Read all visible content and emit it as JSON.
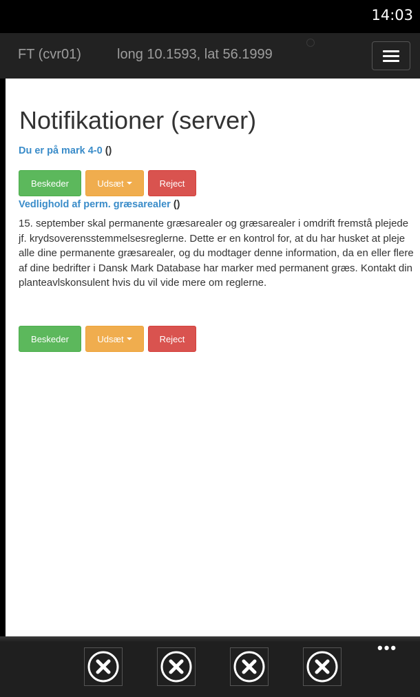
{
  "status_bar": {
    "time": "14:03"
  },
  "navbar": {
    "brand": "FT (cvr01)",
    "location": "long 10.1593, lat 56.1999",
    "menu_icon": "hamburger-menu-icon"
  },
  "page": {
    "title": "Notifikationer (server)"
  },
  "notifications": [
    {
      "title": "Du er på mark 4-0",
      "suffix": " ()",
      "body": "",
      "buttons": {
        "messages": "Beskeder",
        "postpone": "Udsæt",
        "reject": "Reject"
      }
    },
    {
      "title": "Vedlighold af perm. græsarealer",
      "suffix": " ()",
      "body": "15. september skal permanente græsarealer og græsarealer i omdrift fremstå plejede jf. krydsoverensstemmelsesreglerne. Dette er en kontrol for, at du har husket at pleje alle dine permanente græsarealer, og du modtager denne information, da en eller flere af dine bedrifter i Dansk Mark Database har marker med permanent græs. Kontakt din planteavlskonsulent hvis du vil vide mere om reglerne.",
      "buttons": {
        "messages": "Beskeder",
        "postpone": "Udsæt",
        "reject": "Reject"
      }
    }
  ],
  "app_bar": {
    "buttons": [
      {
        "icon": "close-circle-icon"
      },
      {
        "icon": "close-circle-icon"
      },
      {
        "icon": "close-circle-icon"
      },
      {
        "icon": "close-circle-icon"
      }
    ],
    "more": "•••"
  },
  "colors": {
    "link": "#3a8cc9",
    "success": "#5cb85c",
    "warning": "#f0ad4e",
    "danger": "#d9534f",
    "navbar": "#222222"
  }
}
